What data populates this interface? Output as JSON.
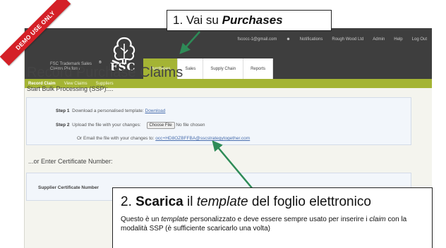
{
  "header": {
    "platform_name": "FSC Trademark Sales Claims Platform",
    "logo_text": "FSC",
    "logo_mark": "®",
    "user_email": "fscocc-1@gmail.com",
    "notifications": "Notifications",
    "company": "Rough Wood Ltd",
    "admin": "Admin",
    "help": "Help",
    "logout": "Log Out"
  },
  "main_nav": [
    {
      "label": "Purchases",
      "active": true
    },
    {
      "label": "Sales",
      "active": false
    },
    {
      "label": "Supply Chain",
      "active": false
    },
    {
      "label": "Reports",
      "active": false
    }
  ],
  "subnav": [
    {
      "label": "Record Claim",
      "active": true
    },
    {
      "label": "View Claims",
      "active": false
    },
    {
      "label": "Suppliers",
      "active": false
    }
  ],
  "page": {
    "title": "Record Purchase Claims",
    "bulk_heading": "Start Bulk Processing (SSP):...",
    "step1_label": "Step 1",
    "step1_text": "Download a personalised template:",
    "step1_link": "Download",
    "step2_label": "Step 2",
    "step2_text": "Upload the file with your changes:",
    "choose_file": "Choose File",
    "no_file": "No file chosen",
    "email_text": "Or Email the file with your changes to:",
    "email_link": "occ+HD8OZBFFBA@sscstrategytogether.com",
    "or_enter": "...or Enter Certificate Number:",
    "supplier_label": "Supplier Certificate Number"
  },
  "demo_ribbon": "DEMO USE ONLY",
  "callout1": {
    "prefix": "1. Vai su ",
    "emphasis": "Purchases"
  },
  "callout2": {
    "title_num": "2. ",
    "title_bold": "Scarica",
    "title_mid": " il ",
    "title_italic": "template",
    "title_end": " del foglio elettronico",
    "body_a": "Questo è un ",
    "body_italic1": "template",
    "body_b": " personalizzato e deve essere sempre usato per inserire i ",
    "body_italic2": "claim",
    "body_c": " con la modalità SSP (è sufficiente scaricarlo una volta)"
  },
  "colors": {
    "accent": "#a4b434",
    "header": "#3e3e3e",
    "ribbon": "#d42027",
    "arrow": "#2e8b57"
  }
}
